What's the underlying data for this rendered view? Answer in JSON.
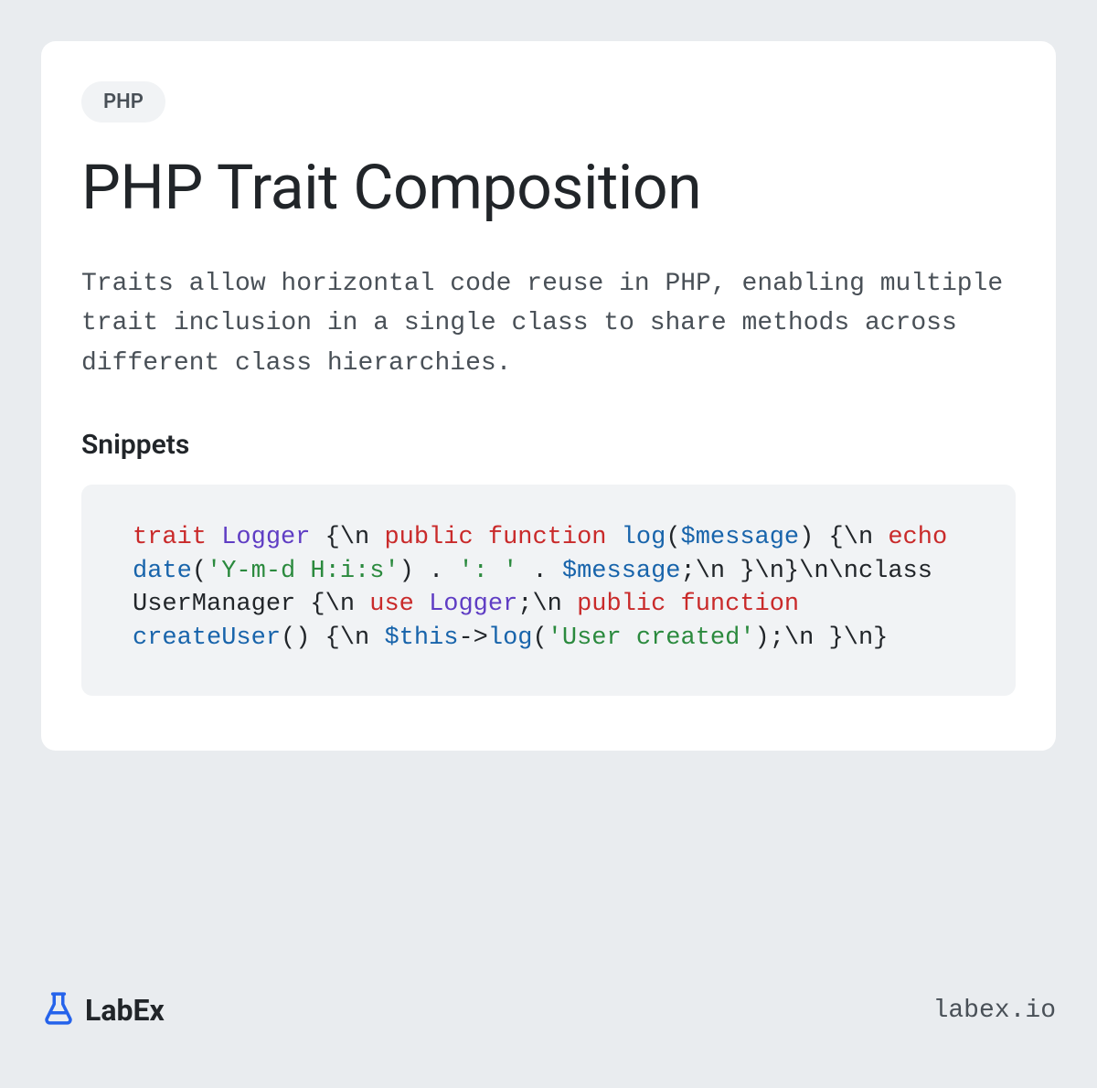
{
  "badge": "PHP",
  "title": "PHP Trait Composition",
  "description": "Traits allow horizontal code reuse in PHP, enabling multiple trait inclusion in a single class to share methods across different class hierarchies.",
  "snippets_heading": "Snippets",
  "code_tokens": [
    {
      "c": "kw",
      "t": "trait"
    },
    {
      "c": "",
      "t": " "
    },
    {
      "c": "cls",
      "t": "Logger"
    },
    {
      "c": "",
      "t": " {\\n    "
    },
    {
      "c": "kw",
      "t": "public"
    },
    {
      "c": "",
      "t": " "
    },
    {
      "c": "kw",
      "t": "function"
    },
    {
      "c": "",
      "t": " "
    },
    {
      "c": "fn",
      "t": "log"
    },
    {
      "c": "",
      "t": "("
    },
    {
      "c": "var",
      "t": "$message"
    },
    {
      "c": "",
      "t": ") {\\n        "
    },
    {
      "c": "kw",
      "t": "echo"
    },
    {
      "c": "",
      "t": " "
    },
    {
      "c": "fn",
      "t": "date"
    },
    {
      "c": "",
      "t": "("
    },
    {
      "c": "str",
      "t": "'Y-m-d H:i:s'"
    },
    {
      "c": "",
      "t": ") . "
    },
    {
      "c": "str",
      "t": "': '"
    },
    {
      "c": "",
      "t": " . "
    },
    {
      "c": "var",
      "t": "$message"
    },
    {
      "c": "",
      "t": ";\\n    }\\n}\\n\\nclass UserManager {\\n    "
    },
    {
      "c": "kw",
      "t": "use"
    },
    {
      "c": "",
      "t": " "
    },
    {
      "c": "cls",
      "t": "Logger"
    },
    {
      "c": "",
      "t": ";\\n    "
    },
    {
      "c": "kw",
      "t": "public"
    },
    {
      "c": "",
      "t": " "
    },
    {
      "c": "kw",
      "t": "function"
    },
    {
      "c": "",
      "t": " "
    },
    {
      "c": "fn",
      "t": "createUser"
    },
    {
      "c": "",
      "t": "() {\\n        "
    },
    {
      "c": "var",
      "t": "$this"
    },
    {
      "c": "",
      "t": "->"
    },
    {
      "c": "fn",
      "t": "log"
    },
    {
      "c": "",
      "t": "("
    },
    {
      "c": "str",
      "t": "'User created'"
    },
    {
      "c": "",
      "t": ");\\n    }\\n}"
    }
  ],
  "footer": {
    "brand": "LabEx",
    "url": "labex.io"
  }
}
